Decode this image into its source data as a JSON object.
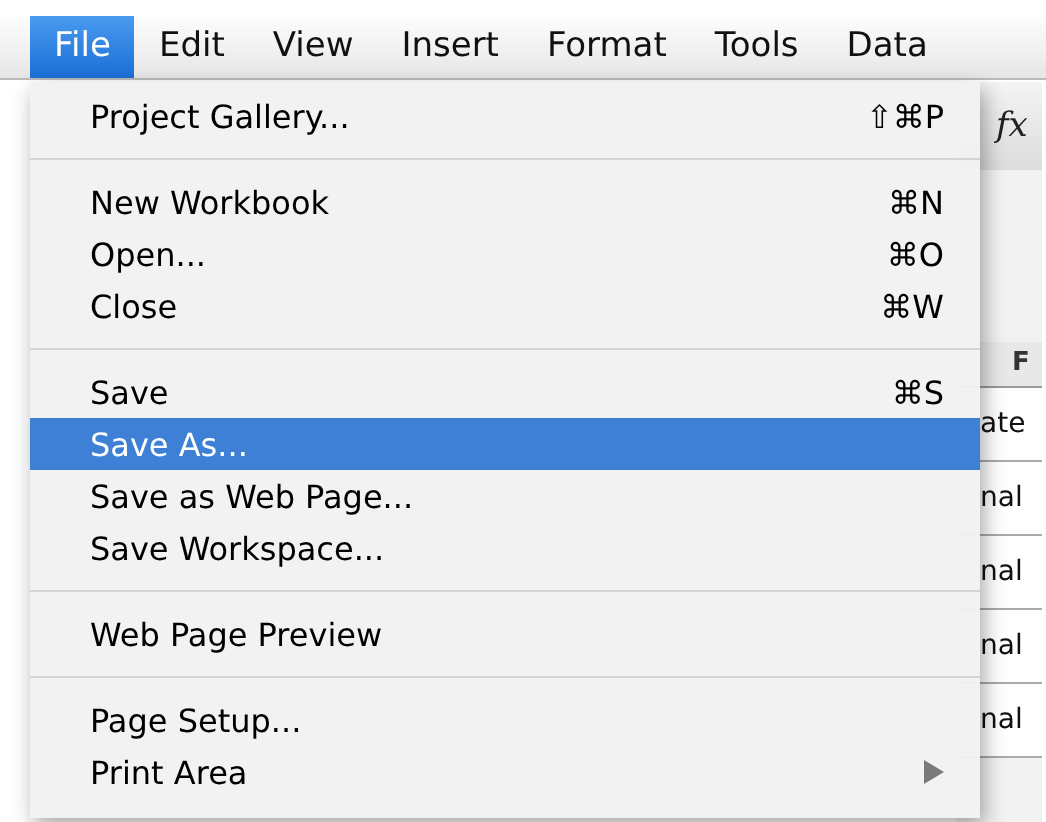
{
  "menubar": [
    {
      "label": "File",
      "selected": true
    },
    {
      "label": "Edit",
      "selected": false
    },
    {
      "label": "View",
      "selected": false
    },
    {
      "label": "Insert",
      "selected": false
    },
    {
      "label": "Format",
      "selected": false
    },
    {
      "label": "Tools",
      "selected": false
    },
    {
      "label": "Data",
      "selected": false
    }
  ],
  "menu": {
    "items": [
      {
        "kind": "item",
        "label": "Project Gallery...",
        "shortcut": "⇧⌘P",
        "selected": false
      },
      {
        "kind": "separator"
      },
      {
        "kind": "item",
        "label": "New Workbook",
        "shortcut": "⌘N",
        "selected": false
      },
      {
        "kind": "item",
        "label": "Open...",
        "shortcut": "⌘O",
        "selected": false
      },
      {
        "kind": "item",
        "label": "Close",
        "shortcut": "⌘W",
        "selected": false
      },
      {
        "kind": "separator"
      },
      {
        "kind": "item",
        "label": "Save",
        "shortcut": "⌘S",
        "selected": false
      },
      {
        "kind": "item",
        "label": "Save As...",
        "selected": true
      },
      {
        "kind": "item",
        "label": "Save as Web Page...",
        "selected": false
      },
      {
        "kind": "item",
        "label": "Save Workspace...",
        "selected": false
      },
      {
        "kind": "separator"
      },
      {
        "kind": "item",
        "label": "Web Page Preview",
        "selected": false
      },
      {
        "kind": "separator"
      },
      {
        "kind": "item",
        "label": "Page Setup...",
        "selected": false
      },
      {
        "kind": "submenu",
        "label": "Print Area",
        "selected": false
      }
    ]
  },
  "sheet": {
    "formula_label": "fx",
    "column_header": "F",
    "cells": [
      "ate",
      "nal",
      "nal",
      "nal",
      "nal"
    ]
  }
}
